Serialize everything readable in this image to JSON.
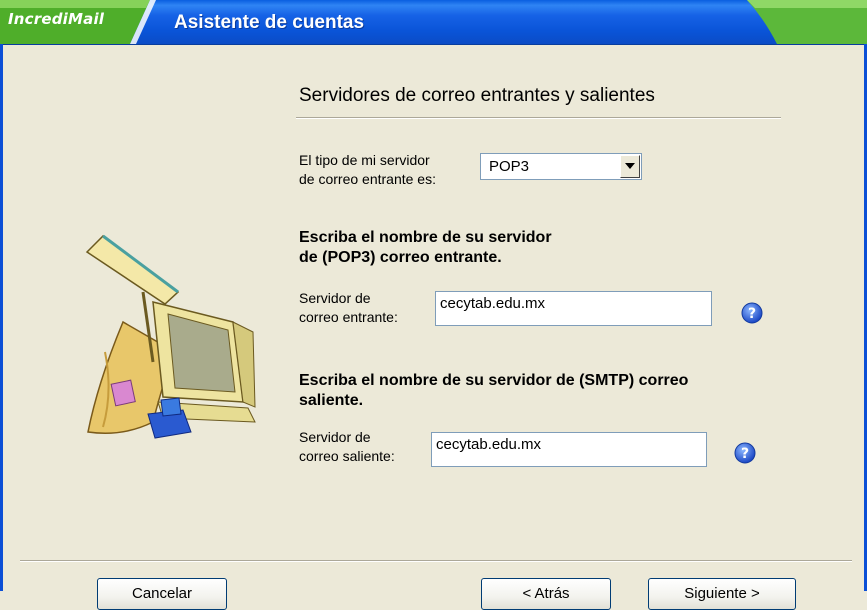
{
  "window": {
    "logo": "IncrediMail",
    "title": "Asistente de cuentas"
  },
  "page": {
    "heading": "Servidores de correo entrantes y salientes"
  },
  "server_type": {
    "label_line1": "El tipo de mi servidor",
    "label_line2": "de correo entrante es:",
    "selected": "POP3"
  },
  "incoming": {
    "instruction_line1": "Escriba el nombre de su servidor",
    "instruction_line2": "de (POP3) correo entrante.",
    "label_line1": "Servidor de",
    "label_line2": "correo entrante:",
    "value": "cecytab.edu.mx"
  },
  "outgoing": {
    "instruction_line1": "Escriba el nombre de su servidor de (SMTP) correo",
    "instruction_line2": "saliente.",
    "label_line1": "Servidor de",
    "label_line2": "correo saliente:",
    "value": "cecytab.edu.mx"
  },
  "buttons": {
    "cancel": "Cancelar",
    "back": "< Atrás",
    "next": "Siguiente >"
  },
  "icons": {
    "help": "help-icon",
    "dropdown": "chevron-down-icon",
    "illustration": "computer-mail-illustration"
  }
}
